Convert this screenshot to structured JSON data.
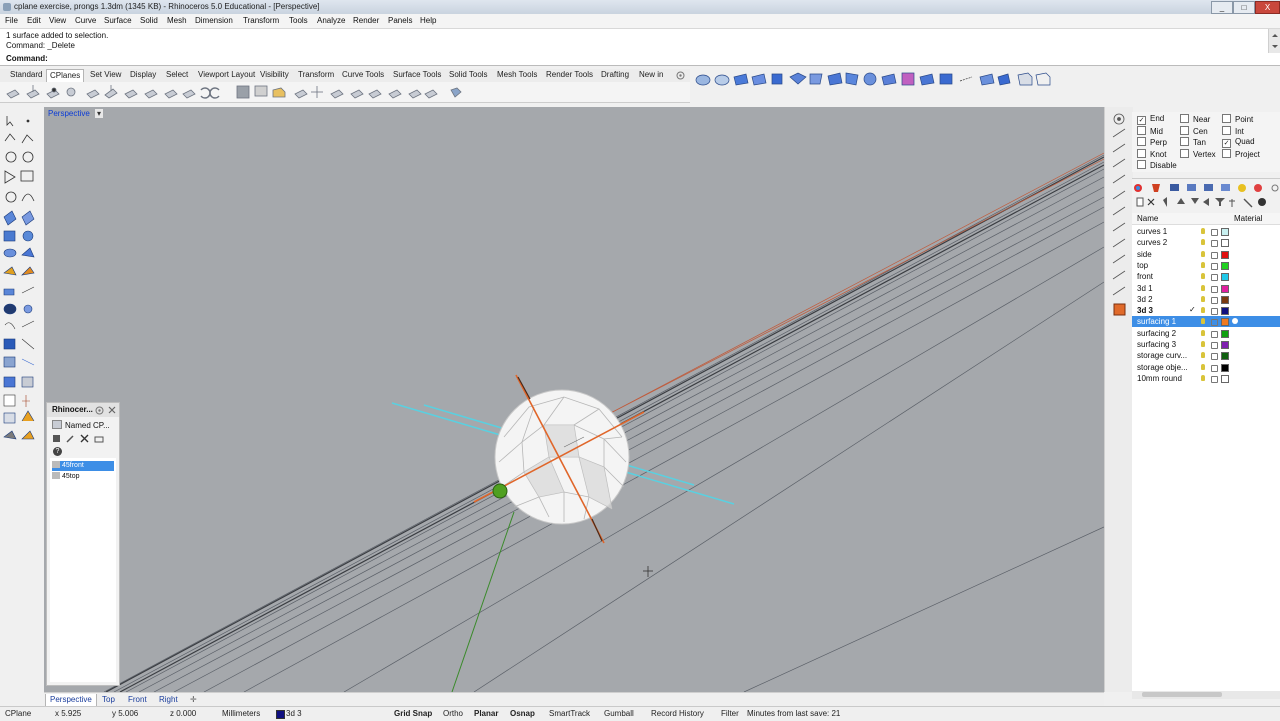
{
  "window": {
    "title": "cplane exercise, prongs 1.3dm (1345 KB) - Rhinoceros 5.0 Educational - [Perspective]",
    "minimize": "_",
    "maximize": "□",
    "close": "X"
  },
  "menu": [
    "File",
    "Edit",
    "View",
    "Curve",
    "Surface",
    "Solid",
    "Mesh",
    "Dimension",
    "Transform",
    "Tools",
    "Analyze",
    "Render",
    "Panels",
    "Help"
  ],
  "command": {
    "history": [
      "1 surface added to selection.",
      "Command: _Delete"
    ],
    "prompt_label": "Command:",
    "value": ""
  },
  "toolbar_tabs": [
    "Standard",
    "CPlanes",
    "Set View",
    "Display",
    "Select",
    "Viewport Layout",
    "Visibility",
    "Transform",
    "Curve Tools",
    "Surface Tools",
    "Solid Tools",
    "Mesh Tools",
    "Render Tools",
    "Drafting",
    "New in"
  ],
  "active_toolbar_tab": "CPlanes",
  "viewport": {
    "title": "Perspective",
    "menu_arrow": "▾"
  },
  "named_cplanes": {
    "title": "Rhinocer...",
    "tab": "Named CP...",
    "items": [
      "45front",
      "45top"
    ],
    "selected": "45front",
    "help": "?"
  },
  "osnap": {
    "items": [
      {
        "label": "End",
        "checked": true
      },
      {
        "label": "Near",
        "checked": false
      },
      {
        "label": "Point",
        "checked": false
      },
      {
        "label": "Mid",
        "checked": false
      },
      {
        "label": "Cen",
        "checked": false
      },
      {
        "label": "Int",
        "checked": false
      },
      {
        "label": "Perp",
        "checked": false
      },
      {
        "label": "Tan",
        "checked": false
      },
      {
        "label": "Quad",
        "checked": true
      },
      {
        "label": "Knot",
        "checked": false
      },
      {
        "label": "Vertex",
        "checked": false
      },
      {
        "label": "Project",
        "checked": false
      },
      {
        "label": "Disable",
        "checked": false
      }
    ]
  },
  "layers": {
    "header_name": "Name",
    "header_material": "Material",
    "items": [
      {
        "name": "curves 1",
        "color": "#c8f0f0",
        "current": false,
        "selected": false
      },
      {
        "name": "curves 2",
        "color": "#ffffff",
        "current": false,
        "selected": false
      },
      {
        "name": "side",
        "color": "#e01010",
        "current": false,
        "selected": false
      },
      {
        "name": "top",
        "color": "#20d020",
        "current": false,
        "selected": false
      },
      {
        "name": "front",
        "color": "#20c8e8",
        "current": false,
        "selected": false
      },
      {
        "name": "3d 1",
        "color": "#e020a0",
        "current": false,
        "selected": false
      },
      {
        "name": "3d 2",
        "color": "#7a3a10",
        "current": false,
        "selected": false
      },
      {
        "name": "3d 3",
        "color": "#101080",
        "current": true,
        "selected": false
      },
      {
        "name": "surfacing 1",
        "color": "#f07a20",
        "current": false,
        "selected": true
      },
      {
        "name": "surfacing 2",
        "color": "#10a010",
        "current": false,
        "selected": false
      },
      {
        "name": "surfacing 3",
        "color": "#8020b0",
        "current": false,
        "selected": false
      },
      {
        "name": "storage curv...",
        "color": "#106010",
        "current": false,
        "selected": false
      },
      {
        "name": "storage obje...",
        "color": "#000000",
        "current": false,
        "selected": false
      },
      {
        "name": "10mm round",
        "color": "#ffffff",
        "current": false,
        "selected": false
      }
    ],
    "current_check": "✓"
  },
  "viewport_tabs": [
    "Perspective",
    "Top",
    "Front",
    "Right"
  ],
  "active_viewport_tab": "Perspective",
  "add_tab": "✛",
  "status": {
    "cplane": "CPlane",
    "x": "x 5.925",
    "y": "y 5.006",
    "z": "z 0.000",
    "units": "Millimeters",
    "layer": "3d 3",
    "layer_color": "#101080",
    "grid_snap": "Grid Snap",
    "ortho": "Ortho",
    "planar": "Planar",
    "osnap": "Osnap",
    "smarttrack": "SmartTrack",
    "gumball": "Gumball",
    "record_history": "Record History",
    "filter": "Filter",
    "last_save": "Minutes from last save: 21"
  }
}
